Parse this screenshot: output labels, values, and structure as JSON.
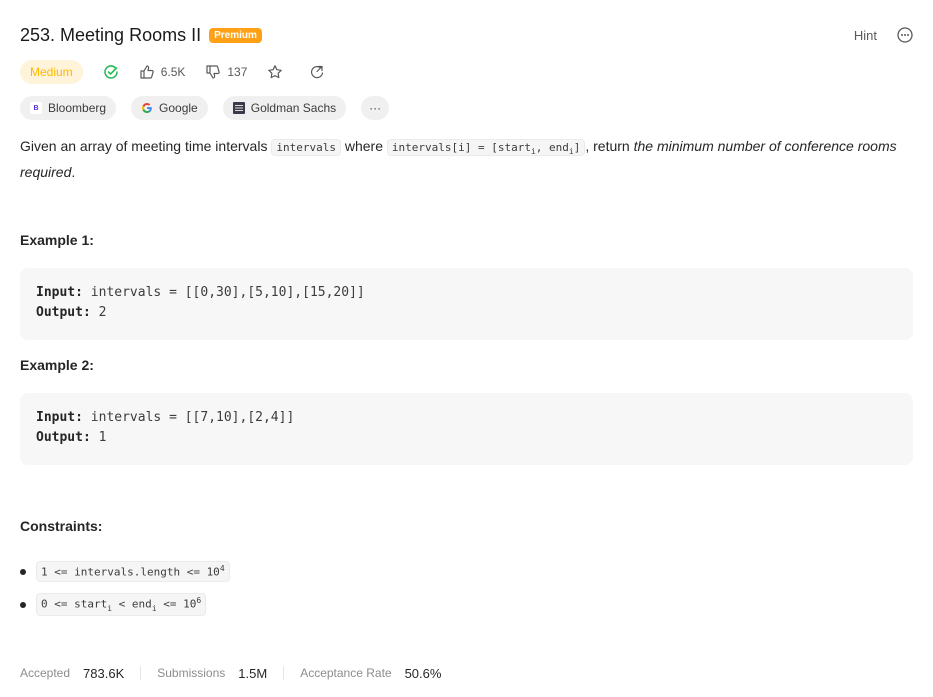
{
  "problem": {
    "title": "253. Meeting Rooms II",
    "premium_badge": "Premium",
    "hint_label": "Hint"
  },
  "meta": {
    "difficulty": "Medium",
    "likes": "6.5K",
    "dislikes": "137"
  },
  "companies": [
    {
      "name": "Bloomberg",
      "logo": "B"
    },
    {
      "name": "Google",
      "logo": "G"
    },
    {
      "name": "Goldman Sachs",
      "logo": "GS"
    }
  ],
  "companies_more": "···",
  "description": {
    "p1": "Given an array of meeting time intervals ",
    "code1": "intervals",
    "p2": " where ",
    "code2_a": "intervals[i] = [start",
    "code2_sub1": "i",
    "code2_b": ", end",
    "code2_sub2": "i",
    "code2_c": "]",
    "p3": ", return ",
    "emph": "the minimum number of conference rooms required",
    "p4": "."
  },
  "examples": [
    {
      "heading": "Example 1:",
      "input_label": "Input:",
      "input": "intervals = [[0,30],[5,10],[15,20]]",
      "output_label": "Output:",
      "output": "2"
    },
    {
      "heading": "Example 2:",
      "input_label": "Input:",
      "input": "intervals = [[7,10],[2,4]]",
      "output_label": "Output:",
      "output": "1"
    }
  ],
  "constraints": {
    "heading": "Constraints:",
    "c1_text": "1 <= intervals.length <= 10",
    "c1_sup": "4",
    "c2_a": "0 <= start",
    "c2_sub1": "i",
    "c2_b": " < end",
    "c2_sub2": "i",
    "c2_c": " <= 10",
    "c2_sup": "6"
  },
  "stats": {
    "accepted_label": "Accepted",
    "accepted_value": "783.6K",
    "submissions_label": "Submissions",
    "submissions_value": "1.5M",
    "rate_label": "Acceptance Rate",
    "rate_value": "50.6%"
  },
  "colors": {
    "premium": "#ffa116",
    "difficulty_medium": "#ffb800",
    "solved_check": "#2cbb5d"
  },
  "icons": [
    "solved-check-icon",
    "thumbs-up-icon",
    "thumbs-down-icon",
    "star-icon",
    "share-icon",
    "more-circle-icon",
    "google-logo-icon"
  ]
}
